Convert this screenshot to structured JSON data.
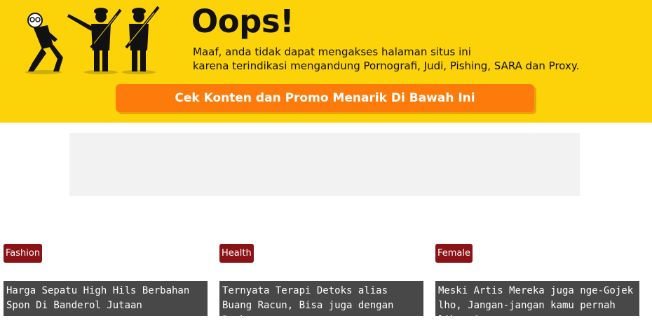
{
  "banner": {
    "title": "Oops!",
    "message_line1": "Maaf, anda tidak dapat mengakses halaman situs ini",
    "message_line2": "karena terindikasi mengandung Pornografi, Judi, Pishing, SARA dan Proxy.",
    "cta_label": "Cek Konten dan Promo Menarik Di Bawah Ini",
    "bg_color": "#fcd208",
    "cta_color": "#fd7b0a",
    "illustration": "police-chasing-thief-illustration"
  },
  "cards": [
    {
      "tag": "Fashion",
      "headline": "Harga Sepatu High Hils Berbahan Spon Di Banderol Jutaan"
    },
    {
      "tag": "Health",
      "headline": "Ternyata Terapi Detoks alias Buang Racun, Bisa juga dengan Buah"
    },
    {
      "tag": "Female",
      "headline": "Meski Artis Mereka juga nge-Gojek lho, Jangan-jangan kamu pernah lihat ?"
    }
  ],
  "colors": {
    "tag_bg": "#8b1316",
    "headline_bg": "#484848"
  }
}
